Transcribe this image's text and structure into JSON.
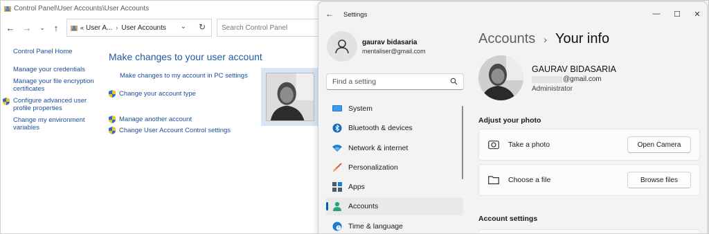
{
  "control_panel": {
    "title": "Control Panel\\User Accounts\\User Accounts",
    "address": {
      "crumb_overflow": "«",
      "crumb_1": "User A...",
      "crumb_2": "User Accounts"
    },
    "search_placeholder": "Search Control Panel",
    "left_links": [
      "Control Panel Home",
      "Manage your credentials",
      "Manage your file encryption certificates",
      "Configure advanced user profile properties",
      "Change my environment variables"
    ],
    "heading": "Make changes to your user account",
    "main_links": [
      "Make changes to my account in PC settings",
      "Change your account type",
      "Manage another account",
      "Change User Account Control settings"
    ]
  },
  "settings": {
    "title": "Settings",
    "window_controls": [
      "minimize",
      "maximize",
      "close"
    ],
    "user": {
      "name": "gaurav bidasaria",
      "email": "mentaliser@gmail.com"
    },
    "search_placeholder": "Find a setting",
    "nav": [
      {
        "label": "System",
        "icon": "system-icon"
      },
      {
        "label": "Bluetooth & devices",
        "icon": "bluetooth-icon"
      },
      {
        "label": "Network & internet",
        "icon": "wifi-icon"
      },
      {
        "label": "Personalization",
        "icon": "brush-icon"
      },
      {
        "label": "Apps",
        "icon": "apps-icon"
      },
      {
        "label": "Accounts",
        "icon": "accounts-icon",
        "active": true
      },
      {
        "label": "Time & language",
        "icon": "globe-clock-icon"
      }
    ],
    "breadcrumb": {
      "parent": "Accounts",
      "separator": "›",
      "current": "Your info"
    },
    "profile": {
      "name": "GAURAV BIDASARIA",
      "email_suffix": "@gmail.com",
      "role": "Administrator"
    },
    "adjust_photo": {
      "heading": "Adjust your photo",
      "take_photo": {
        "label": "Take a photo",
        "button": "Open Camera"
      },
      "choose_file": {
        "label": "Choose a file",
        "button": "Browse files"
      }
    },
    "account_settings_heading": "Account settings"
  },
  "colors": {
    "accent": "#005fb8",
    "link": "#1a4e9a",
    "cp_heading": "#1e5aa8",
    "settings_bg": "#f3f3f3"
  }
}
